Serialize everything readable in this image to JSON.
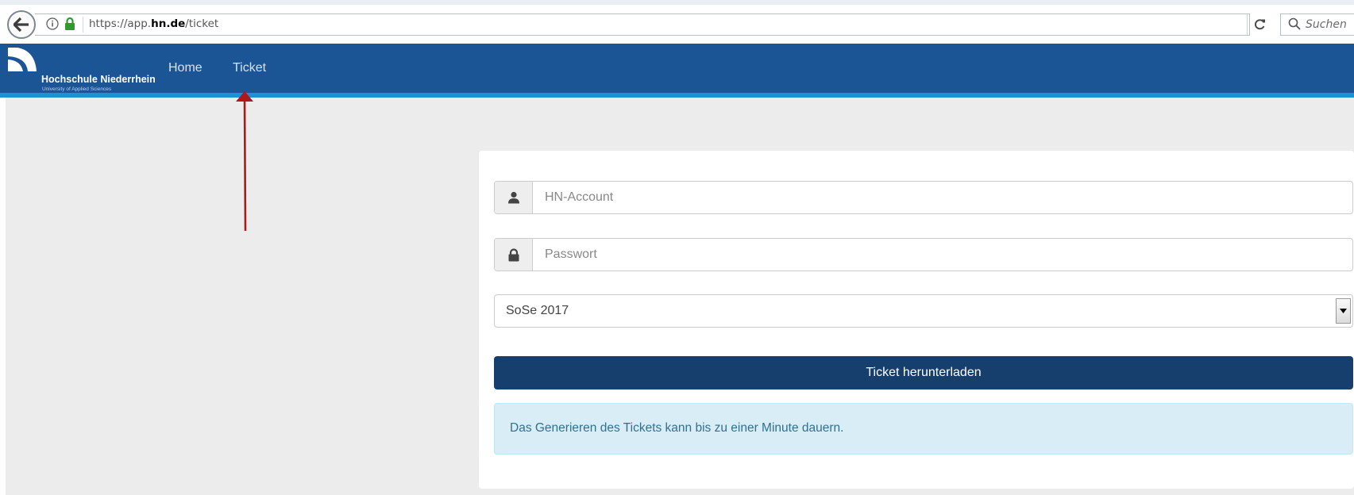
{
  "browser": {
    "url_scheme": "https://app.",
    "url_host": "hn.de",
    "url_path": "/ticket",
    "search_placeholder": "Suchen"
  },
  "site": {
    "logo_name": "Hochschule Niederrhein",
    "logo_subtitle": "University of Applied Sciences",
    "nav": {
      "home": "Home",
      "ticket": "Ticket"
    }
  },
  "form": {
    "account_placeholder": "HN-Account",
    "password_placeholder": "Passwort",
    "semester_selected": "SoSe 2017",
    "submit_label": "Ticket herunterladen",
    "info_message": "Das Generieren des Tickets kann bis zu einer Minute dauern."
  },
  "colors": {
    "navbar": "#1c5596",
    "navbar_accent": "#1993d4",
    "button": "#173f6e",
    "alert_bg": "#d9edf7",
    "annotation_arrow": "#b01818"
  }
}
